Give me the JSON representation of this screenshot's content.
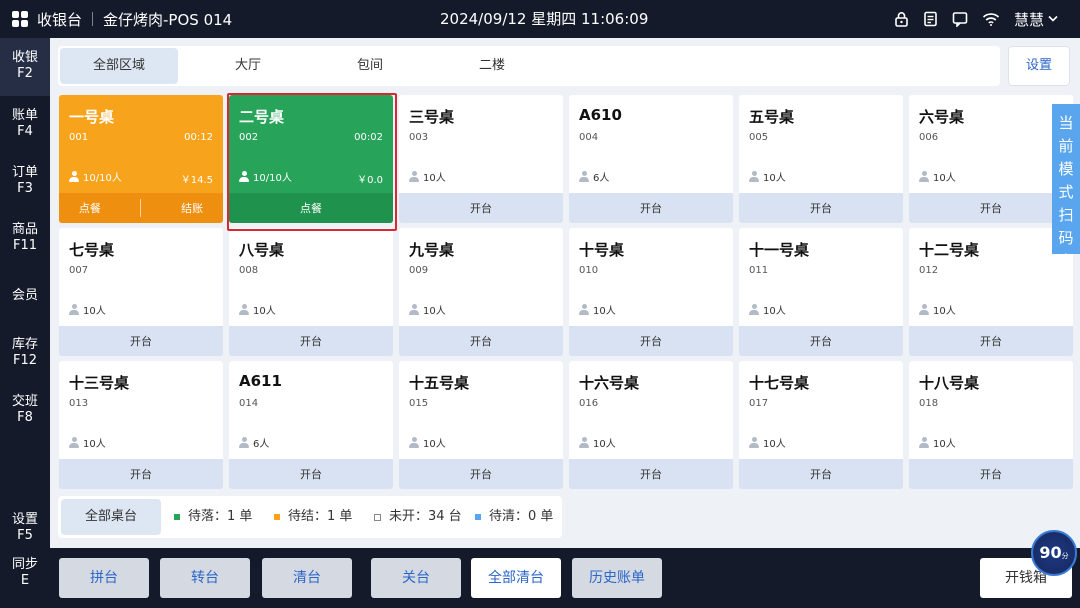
{
  "topbar": {
    "app_title": "收银台",
    "store_name": "金仔烤肉-POS 014",
    "datetime": "2024/09/12 星期四 11:06:09",
    "user": "慧慧"
  },
  "sidebar": [
    {
      "label": "收银",
      "key": "F2"
    },
    {
      "label": "账单",
      "key": "F4"
    },
    {
      "label": "订单",
      "key": "F3"
    },
    {
      "label": "商品",
      "key": "F11"
    },
    {
      "label": "会员",
      "key": ""
    },
    {
      "label": "库存",
      "key": "F12"
    },
    {
      "label": "交班",
      "key": "F8"
    },
    {
      "label": "设置",
      "key": "F5"
    },
    {
      "label": "同步",
      "key": "E"
    }
  ],
  "tabs": [
    "全部区域",
    "大厅",
    "包间",
    "二楼"
  ],
  "settings_label": "设置",
  "scan_mode_label": "当前模式扫码点餐",
  "tables": [
    {
      "name": "一号桌",
      "code": "001",
      "time": "00:12",
      "guests": "10/10人",
      "amount": "￥14.5",
      "actions": [
        "点餐",
        "结账"
      ],
      "status": "pending_settle"
    },
    {
      "name": "二号桌",
      "code": "002",
      "time": "00:02",
      "guests": "10/10人",
      "amount": "￥0.0",
      "actions": [
        "点餐"
      ],
      "status": "pending_order"
    },
    {
      "name": "三号桌",
      "code": "003",
      "guests": "10人",
      "actions": [
        "开台"
      ],
      "status": "closed"
    },
    {
      "name": "A610",
      "code": "004",
      "guests": "6人",
      "actions": [
        "开台"
      ],
      "status": "closed"
    },
    {
      "name": "五号桌",
      "code": "005",
      "guests": "10人",
      "actions": [
        "开台"
      ],
      "status": "closed"
    },
    {
      "name": "六号桌",
      "code": "006",
      "guests": "10人",
      "actions": [
        "开台"
      ],
      "status": "closed"
    },
    {
      "name": "七号桌",
      "code": "007",
      "guests": "10人",
      "actions": [
        "开台"
      ],
      "status": "closed"
    },
    {
      "name": "八号桌",
      "code": "008",
      "guests": "10人",
      "actions": [
        "开台"
      ],
      "status": "closed"
    },
    {
      "name": "九号桌",
      "code": "009",
      "guests": "10人",
      "actions": [
        "开台"
      ],
      "status": "closed"
    },
    {
      "name": "十号桌",
      "code": "010",
      "guests": "10人",
      "actions": [
        "开台"
      ],
      "status": "closed"
    },
    {
      "name": "十一号桌",
      "code": "011",
      "guests": "10人",
      "actions": [
        "开台"
      ],
      "status": "closed"
    },
    {
      "name": "十二号桌",
      "code": "012",
      "guests": "10人",
      "actions": [
        "开台"
      ],
      "status": "closed"
    },
    {
      "name": "十三号桌",
      "code": "013",
      "guests": "10人",
      "actions": [
        "开台"
      ],
      "status": "closed"
    },
    {
      "name": "A611",
      "code": "014",
      "guests": "6人",
      "actions": [
        "开台"
      ],
      "status": "closed"
    },
    {
      "name": "十五号桌",
      "code": "015",
      "guests": "10人",
      "actions": [
        "开台"
      ],
      "status": "closed"
    },
    {
      "name": "十六号桌",
      "code": "016",
      "guests": "10人",
      "actions": [
        "开台"
      ],
      "status": "closed"
    },
    {
      "name": "十七号桌",
      "code": "017",
      "guests": "10人",
      "actions": [
        "开台"
      ],
      "status": "closed"
    },
    {
      "name": "十八号桌",
      "code": "018",
      "guests": "10人",
      "actions": [
        "开台"
      ],
      "status": "closed"
    }
  ],
  "legend": {
    "all_label": "全部桌台",
    "items": [
      {
        "text": "待落：1 单",
        "color": "#27a35a"
      },
      {
        "text": "待结：1 单",
        "color": "#f8a31c"
      },
      {
        "text": "未开：34 台",
        "color": "#ffffff"
      },
      {
        "text": "待清：0 单",
        "color": "#59a6ee"
      }
    ]
  },
  "bottom_actions": [
    {
      "label": "拼台",
      "style": "grey"
    },
    {
      "label": "转台",
      "style": "grey"
    },
    {
      "label": "清台",
      "style": "grey"
    },
    {
      "label": "关台",
      "style": "grey"
    },
    {
      "label": "全部清台",
      "style": "white"
    },
    {
      "label": "历史账单",
      "style": "grey"
    }
  ],
  "cash_drawer_label": "开钱箱",
  "timer_badge": {
    "value": "90",
    "unit": "分"
  },
  "colors": {
    "accent_blue": "#2b66c9",
    "pending_settle": "#f8a31c",
    "pending_order": "#27a35a",
    "selected_outline": "#d9282f",
    "dark_bg": "#141a2a"
  }
}
